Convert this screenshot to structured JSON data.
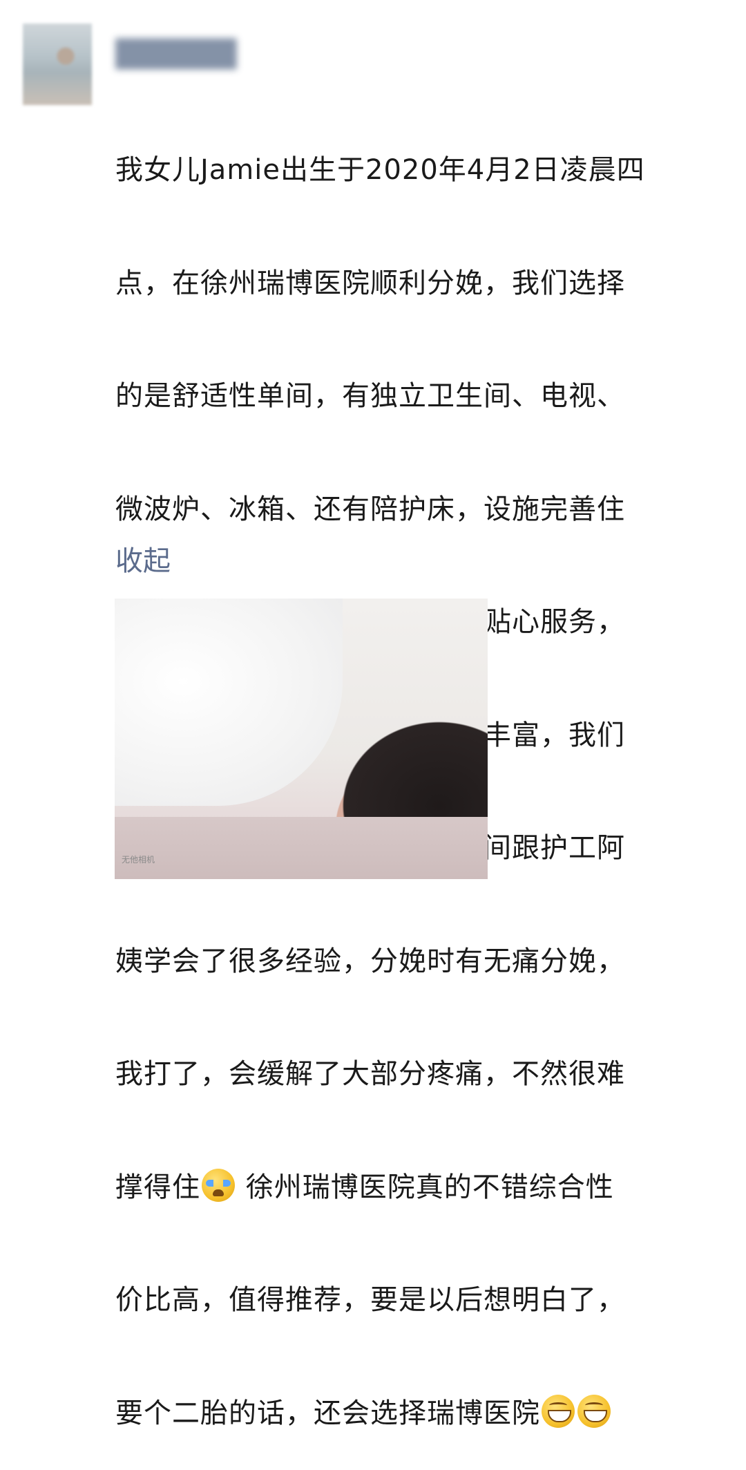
{
  "post": {
    "author_name": "██████",
    "text_lines": [
      "我女儿Jamie出生于2020年4月2日凌晨四",
      "点，在徐州瑞博医院顺利分娩，我们选择",
      "的是舒适性单间，有独立卫生间、电视、",
      "微波炉、冰箱、还有陪护床，设施完善住",
      "的干净舒适，医院有贴心管家贴心服务，",
      "医护人员耐心负责，护工经验丰富，我们",
      "初为父母什么都不会，住院期间跟护工阿",
      "姨学会了很多经验，分娩时有无痛分娩，",
      "我打了，会缓解了大部分疼痛，不然很难"
    ],
    "line10_a": "撑得住",
    "line10_b": "   徐州瑞博医院真的不错综合性",
    "line11": "价比高，值得推荐，要是以后想明白了，",
    "line12": "要个二胎的话，还会选择瑞博医院",
    "collapse_label": "收起",
    "photo_watermark": "无他相机",
    "emojis": [
      "crying-face-icon",
      "grin-icon",
      "grin-icon"
    ]
  },
  "colors": {
    "link": "#5b6b8c",
    "text": "#1a1a1a"
  }
}
